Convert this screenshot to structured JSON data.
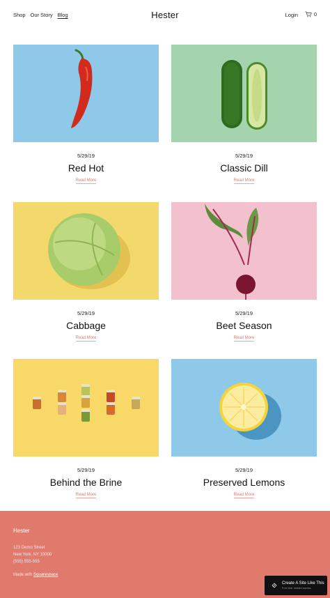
{
  "header": {
    "nav": [
      "Shop",
      "Our Story",
      "Blog"
    ],
    "active_nav": "Blog",
    "logo": "Hester",
    "login": "Login",
    "cart_count": "0"
  },
  "posts": [
    {
      "date": "5/29/19",
      "title": "Red Hot",
      "more": "Read More",
      "bg": "#8ec9ea"
    },
    {
      "date": "5/29/19",
      "title": "Classic Dill",
      "more": "Read More",
      "bg": "#a4d4ad"
    },
    {
      "date": "5/29/19",
      "title": "Cabbage",
      "more": "Read More",
      "bg": "#f3d96b"
    },
    {
      "date": "5/29/19",
      "title": "Beet Season",
      "more": "Read More",
      "bg": "#f2c1cd"
    },
    {
      "date": "5/29/19",
      "title": "Behind the Brine",
      "more": "Read More",
      "bg": "#f8d866"
    },
    {
      "date": "5/29/19",
      "title": "Preserved Lemons",
      "more": "Read More",
      "bg": "#8ec9ea"
    }
  ],
  "footer": {
    "brand": "Hester",
    "address_line1": "123 Demo Street",
    "address_line2": "New York, NY 10000",
    "phone": "(555) 555-555",
    "made_with_prefix": "Made with",
    "made_with_link": "Squarespace",
    "bg": "#e07a6d"
  },
  "badge": {
    "title": "Create A Site Like This",
    "subtitle": "Free trial. Instant access."
  }
}
